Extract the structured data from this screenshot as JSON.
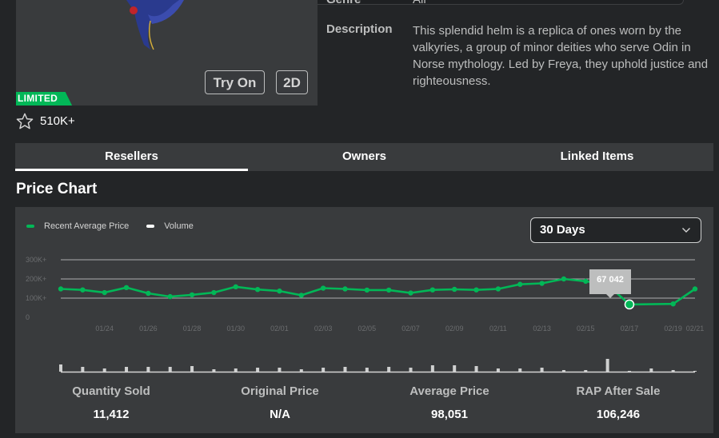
{
  "item": {
    "genre_label": "Genre",
    "genre_value": "All",
    "description_label": "Description",
    "description_text": "This splendid helm is a replica of ones worn by the valkyries, a group of minor deities who serve Odin in Norse mythology. Led by Freya, they uphold justice and righteousness.",
    "try_on_label": "Try On",
    "two_d_label": "2D",
    "limited_badge": "LIMITED",
    "favorites_count": "510K+"
  },
  "tabs": [
    {
      "label": "Resellers",
      "active": true
    },
    {
      "label": "Owners",
      "active": false
    },
    {
      "label": "Linked Items",
      "active": false
    }
  ],
  "chart_section_title": "Price Chart",
  "legend": {
    "price_label": "Recent Average Price",
    "volume_label": "Volume",
    "price_color": "#02b757",
    "volume_color": "#ffffff"
  },
  "period_select": {
    "value": "30 Days"
  },
  "tooltip": {
    "value": "67 042"
  },
  "chart_data": {
    "type": "line",
    "y_ticks": [
      "300K+",
      "200K+",
      "100K+",
      "0"
    ],
    "ylim": [
      0,
      300000
    ],
    "x_tick_labels": [
      "01/24",
      "01/26",
      "01/28",
      "01/30",
      "02/01",
      "02/03",
      "02/05",
      "02/07",
      "02/09",
      "02/11",
      "02/13",
      "02/15",
      "02/17",
      "02/19",
      "02/21"
    ],
    "grid": true,
    "legend_position": "top-left",
    "series": [
      {
        "name": "Recent Average Price",
        "x": [
          "01/22",
          "01/23",
          "01/24",
          "01/25",
          "01/26",
          "01/27",
          "01/28",
          "01/29",
          "01/30",
          "01/31",
          "02/01",
          "02/02",
          "02/03",
          "02/04",
          "02/05",
          "02/06",
          "02/07",
          "02/08",
          "02/09",
          "02/10",
          "02/11",
          "02/12",
          "02/13",
          "02/14",
          "02/15",
          "02/16",
          "02/17",
          "02/18",
          "02/19",
          "02/20"
        ],
        "values": [
          148000,
          143000,
          129000,
          155000,
          125000,
          108000,
          117000,
          129000,
          159000,
          145000,
          137000,
          115000,
          152000,
          148000,
          142000,
          142000,
          127000,
          143000,
          146000,
          143000,
          148000,
          172000,
          177000,
          200000,
          188000,
          170000,
          67042,
          null,
          70000,
          148000
        ]
      },
      {
        "name": "Volume",
        "x": [
          "01/22",
          "01/23",
          "01/24",
          "01/25",
          "01/26",
          "01/27",
          "01/28",
          "01/29",
          "01/30",
          "01/31",
          "02/01",
          "02/02",
          "02/03",
          "02/04",
          "02/05",
          "02/06",
          "02/07",
          "02/08",
          "02/09",
          "02/10",
          "02/11",
          "02/12",
          "02/13",
          "02/14",
          "02/15",
          "02/16",
          "02/17",
          "02/18",
          "02/19",
          "02/20"
        ],
        "values": [
          9,
          6,
          4,
          6,
          6,
          6,
          7,
          3,
          4,
          5,
          5,
          3,
          5,
          6,
          5,
          6,
          5,
          8,
          8,
          7,
          4,
          4,
          5,
          2,
          2,
          16,
          1,
          4,
          2,
          1
        ]
      }
    ]
  },
  "stats": [
    {
      "label": "Quantity Sold",
      "value": "11,412"
    },
    {
      "label": "Original Price",
      "value": "N/A"
    },
    {
      "label": "Average Price",
      "value": "98,051"
    },
    {
      "label": "RAP After Sale",
      "value": "106,246"
    }
  ]
}
